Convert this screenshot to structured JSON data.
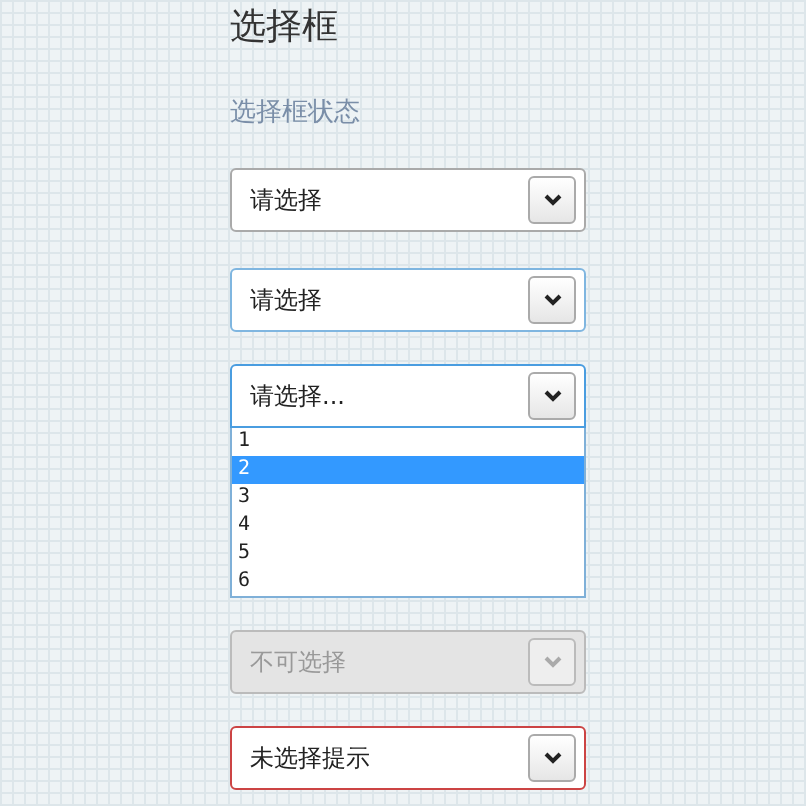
{
  "title": "选择框",
  "section": "选择框状态",
  "selects": [
    {
      "kind": "normal",
      "value": "请选择"
    },
    {
      "kind": "hover",
      "value": "请选择"
    },
    {
      "kind": "open",
      "value": "请选择...",
      "options": [
        {
          "label": "1",
          "selected": false
        },
        {
          "label": "2",
          "selected": true
        },
        {
          "label": "3",
          "selected": false
        },
        {
          "label": "4",
          "selected": false
        },
        {
          "label": "5",
          "selected": false
        },
        {
          "label": "6",
          "selected": false
        }
      ]
    },
    {
      "kind": "disabled",
      "value": "不可选择"
    },
    {
      "kind": "error",
      "value": "未选择提示"
    }
  ]
}
